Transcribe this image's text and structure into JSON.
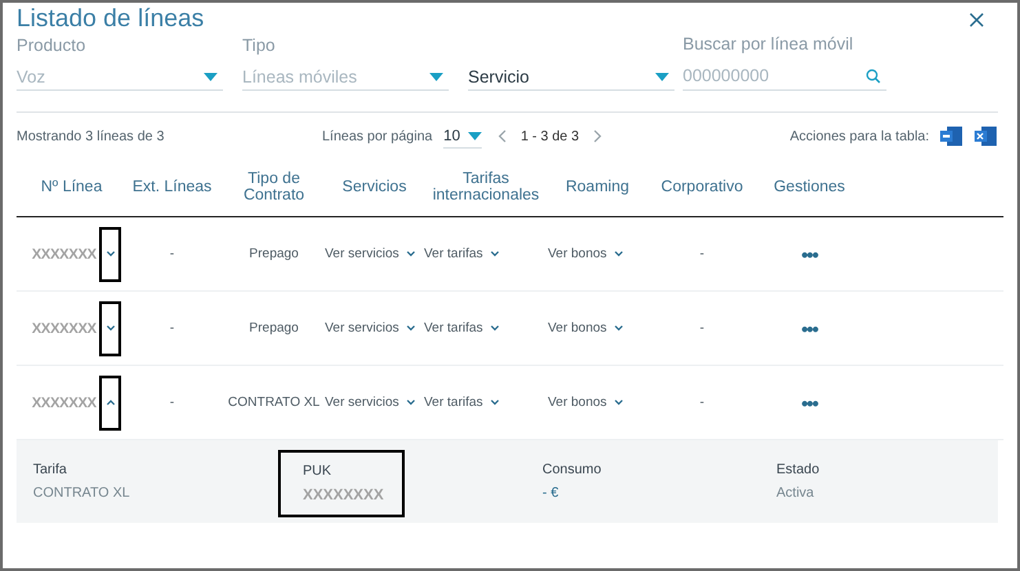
{
  "window": {
    "title": "Listado de líneas"
  },
  "filters": [
    {
      "kind": "select",
      "label": "Producto",
      "value": "Voz",
      "disabled": true
    },
    {
      "kind": "select",
      "label": "Tipo",
      "value": "Líneas móviles",
      "disabled": true
    },
    {
      "kind": "select",
      "value": "Servicio",
      "disabled": false
    },
    {
      "kind": "search",
      "label": "Buscar por línea móvil",
      "placeholder": "000000000"
    }
  ],
  "toolbar": {
    "summary": "Mostrando 3 líneas de 3",
    "per_page_label": "Líneas por página",
    "per_page": "10",
    "range": "1 - 3 de 3",
    "actions_label": "Acciones para la tabla:"
  },
  "table": {
    "columns": [
      "Nº Línea",
      "Ext. Líneas",
      "Tipo de Contrato",
      "Servicios",
      "Tarifas internacionales",
      "Roaming",
      "Corporativo",
      "Gestiones"
    ],
    "rows": [
      {
        "line": "XXXXXXX",
        "expanded": false,
        "highlighted": true,
        "ext": "-",
        "contract": "Prepago",
        "services": "Ver servicios",
        "rates": "Ver tarifas",
        "roaming": "Ver bonos",
        "corporate": "-",
        "actions": "•••"
      },
      {
        "line": "XXXXXXX",
        "expanded": false,
        "highlighted": true,
        "ext": "-",
        "contract": "Prepago",
        "services": "Ver servicios",
        "rates": "Ver tarifas",
        "roaming": "Ver bonos",
        "corporate": "-",
        "actions": "•••"
      },
      {
        "line": "XXXXXXX",
        "expanded": true,
        "highlighted": true,
        "ext": "-",
        "contract": "CONTRATO XL",
        "services": "Ver servicios",
        "rates": "Ver tarifas",
        "roaming": "Ver bonos",
        "corporate": "-",
        "actions": "•••"
      }
    ],
    "detail": [
      {
        "label": "Tarifa",
        "value": "CONTRATO XL",
        "highlighted": false,
        "kind": "text"
      },
      {
        "label": "PUK",
        "value": "XXXXXXXX",
        "highlighted": true,
        "kind": "masked"
      },
      {
        "label": "Consumo",
        "value": "- €",
        "highlighted": false,
        "kind": "amount"
      },
      {
        "label": "Estado",
        "value": "Activa",
        "highlighted": false,
        "kind": "text"
      }
    ]
  }
}
